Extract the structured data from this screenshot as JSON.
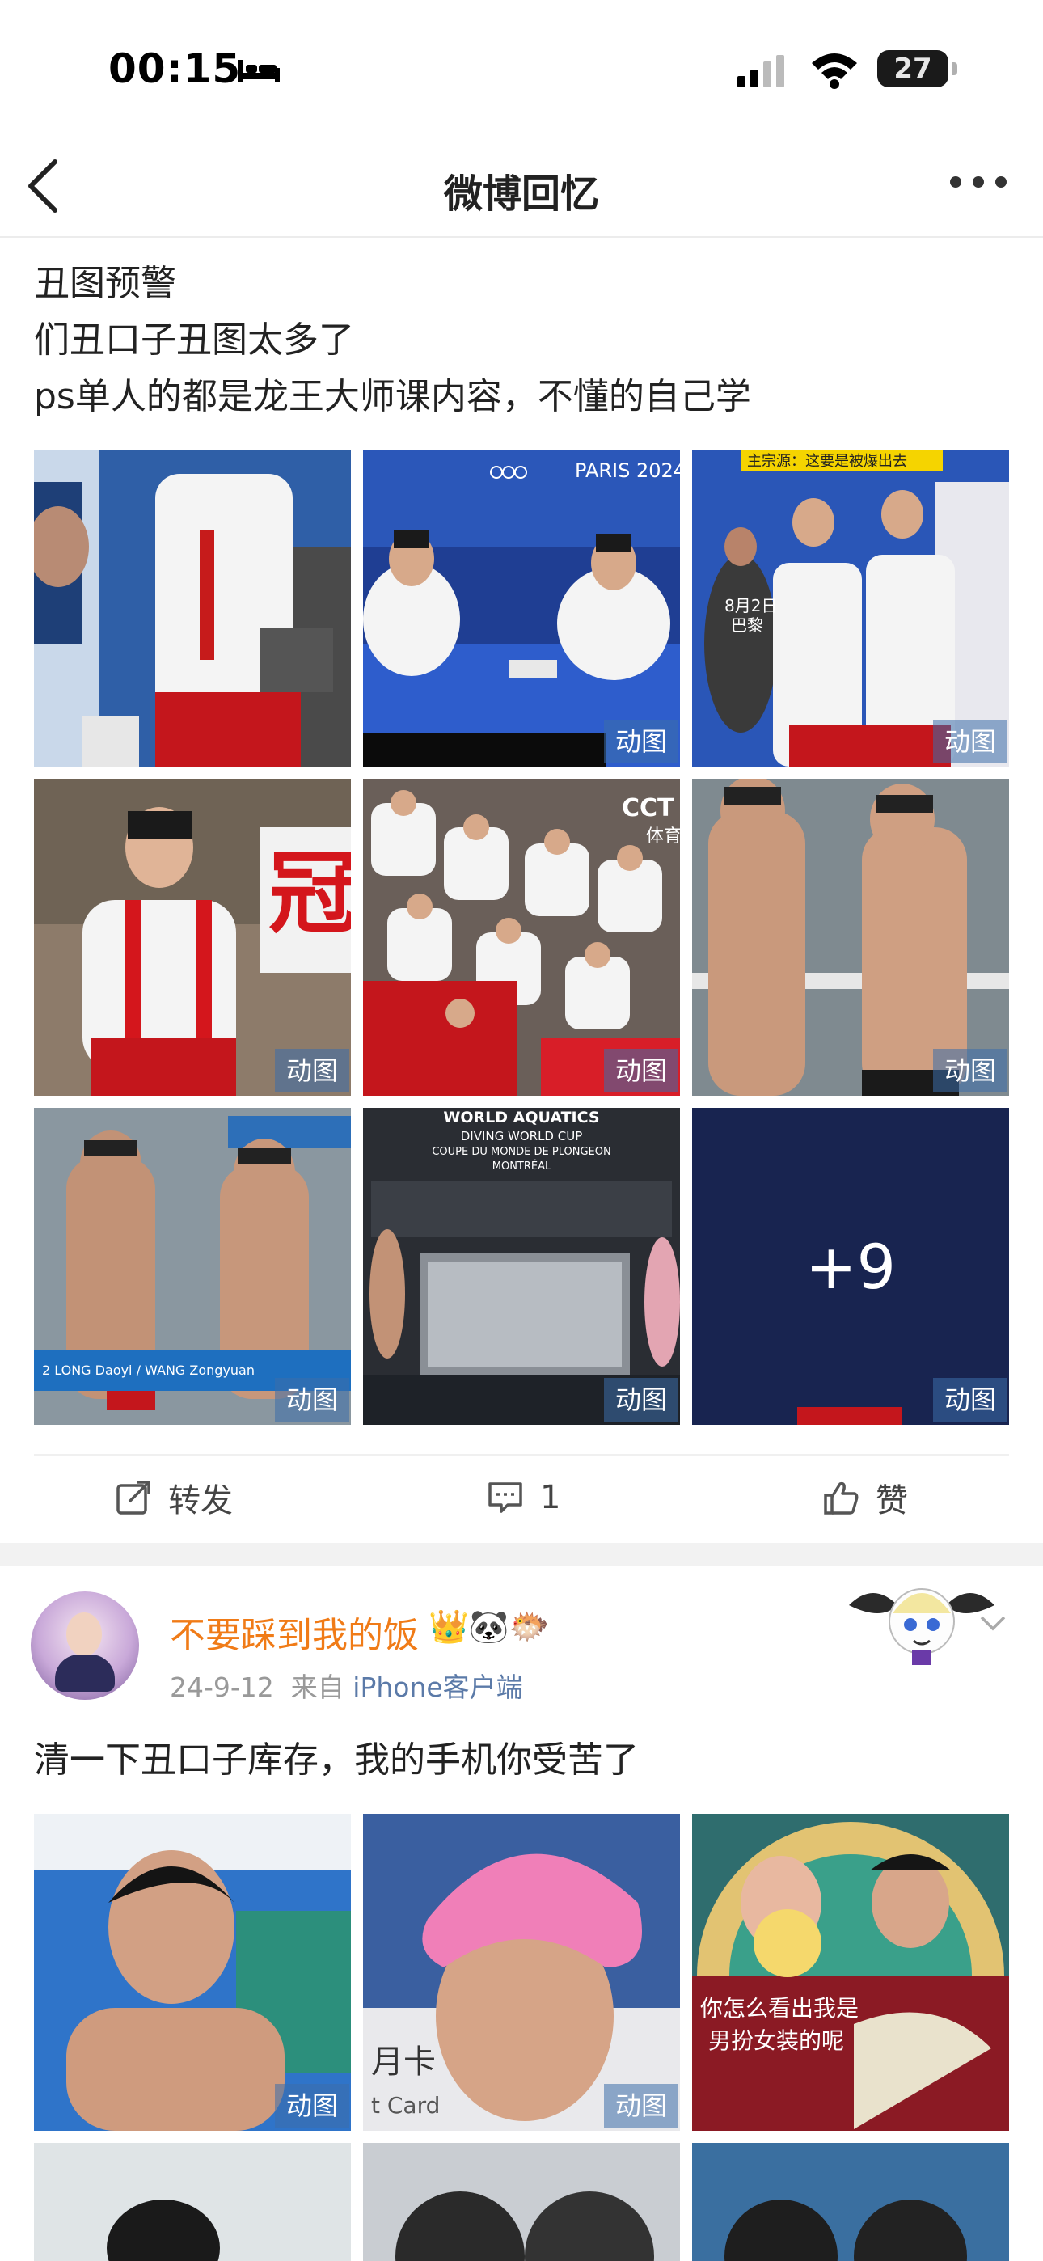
{
  "status_bar": {
    "time": "00:15",
    "battery": "27",
    "icons": [
      "bed-icon",
      "cellular-signal-icon",
      "wifi-icon",
      "battery-icon"
    ]
  },
  "nav": {
    "title": "微博回忆",
    "back_icon": "chevron-left-icon",
    "more_icon": "more-dots-icon"
  },
  "post1": {
    "lines": [
      "丑图预警",
      "们丑口子丑图太多了",
      "ps单人的都是龙王大师课内容，不懂的自己学"
    ],
    "badge_label": "动图",
    "more_count": "+9",
    "thumb_captions": {
      "t1_logo": "PARIS 2024",
      "t2_banner": "主宗源：这要是被爆出去",
      "t2_sticker": "8月2日\n巴黎",
      "t3_text": "冠",
      "t4_logo": "CCTV 体育",
      "t6_bar": "2  LONG Daoyi / WANG Zongyuan",
      "t7_title": "WORLD AQUATICS\nDIVING WORLD CUP\nCOUPE DU MONDE DE PLONGEON\nMONTRÉAL"
    },
    "actions": {
      "repost_label": "转发",
      "comment_count": "1",
      "like_label": "赞"
    },
    "colors": {
      "badge": "#3c6eaa",
      "accent": "#f07b17"
    }
  },
  "post2": {
    "username": "不要踩到我的饭",
    "badges": "👑🐼🐡",
    "date": "24-9-12",
    "source_prefix": "来自",
    "source": "iPhone客户端",
    "text": "清一下丑口子库存，我的手机你受苦了",
    "badge_label": "动图",
    "thumb_captions": {
      "t3_text": "你怎么看出我是\n男扮女装的呢",
      "t2_text": "月卡\nt Card"
    }
  }
}
